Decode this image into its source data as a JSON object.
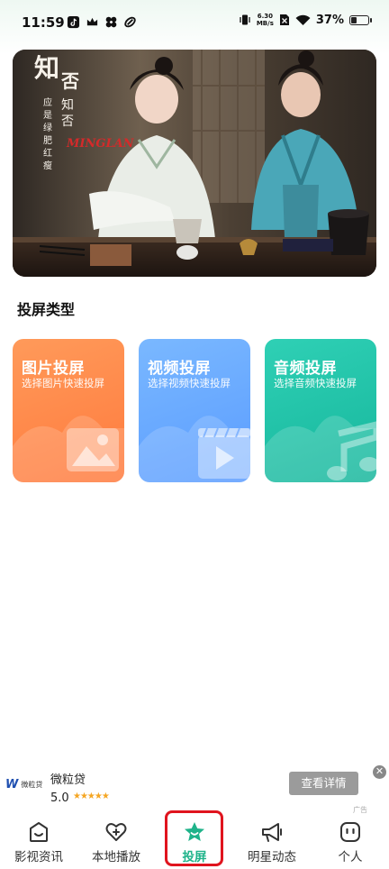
{
  "status_bar": {
    "time": "11:59",
    "net_speed_value": "6.30",
    "net_speed_unit": "MB/s",
    "battery_text": "37%",
    "battery_level_pct": 37,
    "icons": [
      "tiktok-icon",
      "crown-icon",
      "clover-icon",
      "link-icon",
      "vibrate-icon",
      "no-sim-icon",
      "wifi-icon",
      "battery-icon"
    ]
  },
  "banner": {
    "title_art_text": "知否知否 应是绿肥红瘦",
    "title_art_latin": "MINGLAN"
  },
  "section": {
    "title": "投屏类型"
  },
  "cast_types": [
    {
      "title": "图片投屏",
      "subtitle": "选择图片快速投屏",
      "color_from": "#ff9a5a",
      "color_to": "#ff7a3d",
      "icon": "image-icon"
    },
    {
      "title": "视频投屏",
      "subtitle": "选择视频快速投屏",
      "color_from": "#7ab8ff",
      "color_to": "#5a9cff",
      "icon": "video-icon"
    },
    {
      "title": "音频投屏",
      "subtitle": "选择音频快速投屏",
      "color_from": "#2fd0b5",
      "color_to": "#16b69c",
      "icon": "music-note-icon"
    }
  ],
  "ad": {
    "brand_logo": "W",
    "brand_logo_text": "微粒贷",
    "name": "微粒贷",
    "rating": "5.0",
    "stars": "★★★★★",
    "button_label": "查看详情",
    "close": "✕",
    "tag": "广告"
  },
  "bottom_nav": {
    "items": [
      {
        "label": "影视资讯",
        "icon": "tv-smile-icon",
        "active": false
      },
      {
        "label": "本地播放",
        "icon": "heart-plus-icon",
        "active": false
      },
      {
        "label": "投屏",
        "icon": "star-icon",
        "active": true
      },
      {
        "label": "明星动态",
        "icon": "megaphone-icon",
        "active": false
      },
      {
        "label": "个人",
        "icon": "person-face-icon",
        "active": false
      }
    ],
    "active_color": "#1fb38a",
    "highlight_color": "#e0141e"
  }
}
